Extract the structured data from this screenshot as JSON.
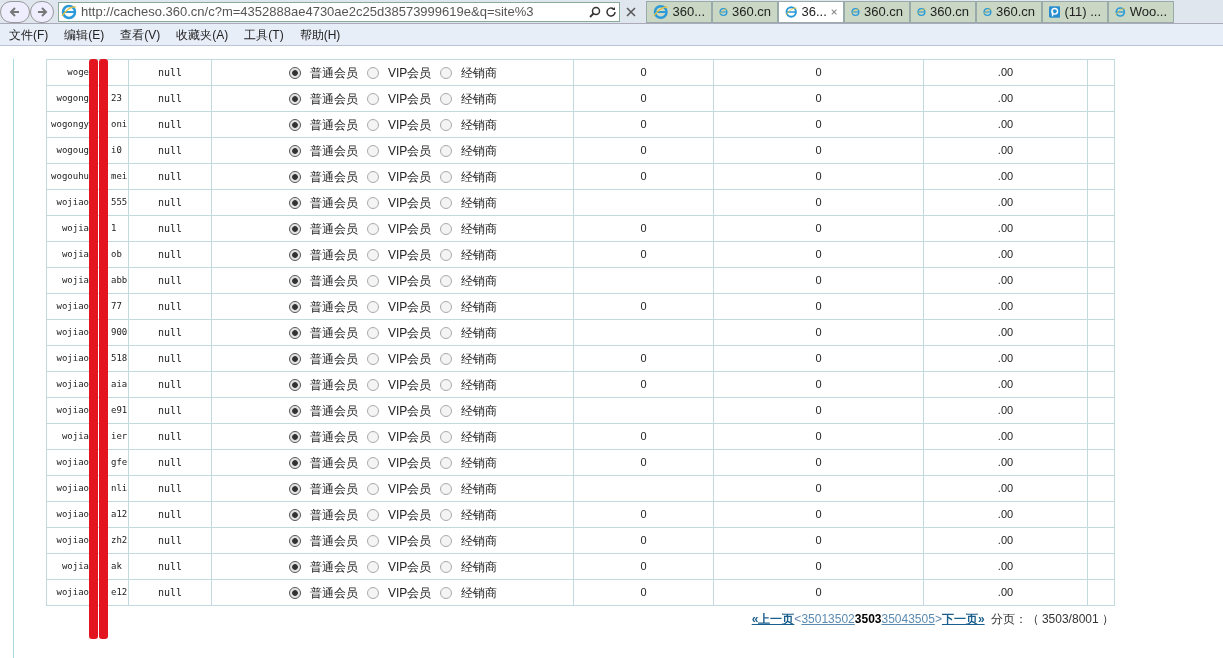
{
  "browser": {
    "url": "http://cacheso.360.cn/c?m=4352888ae4730ae2c25d38573999619e&q=site%3",
    "tabs": [
      {
        "label": "360...",
        "selected": false
      },
      {
        "label": "360.cn",
        "selected": false
      },
      {
        "label": "36...",
        "selected": true
      },
      {
        "label": "360.cn",
        "selected": false
      },
      {
        "label": "360.cn",
        "selected": false
      },
      {
        "label": "360.cn",
        "selected": false
      },
      {
        "label": "(11) ...",
        "selected": false,
        "kind": "p"
      },
      {
        "label": "Woo...",
        "selected": false
      }
    ],
    "menu": [
      "文件(F)",
      "编辑(E)",
      "查看(V)",
      "收藏夹(A)",
      "工具(T)",
      "帮助(H)"
    ]
  },
  "rows": [
    {
      "user_start": "woge",
      "user_end": "",
      "col2": "null",
      "member_options": [
        {
          "label": "普通会员",
          "selected": true
        },
        {
          "label": "VIP会员",
          "selected": false
        },
        {
          "label": "经销商",
          "selected": false
        }
      ],
      "col4": "0",
      "col5": "0",
      "col6": ".00"
    },
    {
      "user_start": "wogong",
      "user_end": "23",
      "col2": "null",
      "member_options": [
        {
          "label": "普通会员",
          "selected": true
        },
        {
          "label": "VIP会员",
          "selected": false
        },
        {
          "label": "经销商",
          "selected": false
        }
      ],
      "col4": "0",
      "col5": "0",
      "col6": ".00"
    },
    {
      "user_start": "wogongy",
      "user_end": "oni",
      "col2": "null",
      "member_options": [
        {
          "label": "普通会员",
          "selected": true
        },
        {
          "label": "VIP会员",
          "selected": false
        },
        {
          "label": "经销商",
          "selected": false
        }
      ],
      "col4": "0",
      "col5": "0",
      "col6": ".00"
    },
    {
      "user_start": "wogoug",
      "user_end": "i0",
      "col2": "null",
      "member_options": [
        {
          "label": "普通会员",
          "selected": true
        },
        {
          "label": "VIP会员",
          "selected": false
        },
        {
          "label": "经销商",
          "selected": false
        }
      ],
      "col4": "0",
      "col5": "0",
      "col6": ".00"
    },
    {
      "user_start": "wogouhu",
      "user_end": "mei",
      "col2": "null",
      "member_options": [
        {
          "label": "普通会员",
          "selected": true
        },
        {
          "label": "VIP会员",
          "selected": false
        },
        {
          "label": "经销商",
          "selected": false
        }
      ],
      "col4": "0",
      "col5": "0",
      "col6": ".00"
    },
    {
      "user_start": "wojiao",
      "user_end": "555",
      "col2": "null",
      "member_options": [
        {
          "label": "普通会员",
          "selected": true
        },
        {
          "label": "VIP会员",
          "selected": false
        },
        {
          "label": "经销商",
          "selected": false
        }
      ],
      "col4": "",
      "col5": "0",
      "col6": ".00"
    },
    {
      "user_start": "wojia",
      "user_end": "1",
      "col2": "null",
      "member_options": [
        {
          "label": "普通会员",
          "selected": true
        },
        {
          "label": "VIP会员",
          "selected": false
        },
        {
          "label": "经销商",
          "selected": false
        }
      ],
      "col4": "0",
      "col5": "0",
      "col6": ".00"
    },
    {
      "user_start": "wojia",
      "user_end": "ob",
      "col2": "null",
      "member_options": [
        {
          "label": "普通会员",
          "selected": true
        },
        {
          "label": "VIP会员",
          "selected": false
        },
        {
          "label": "经销商",
          "selected": false
        }
      ],
      "col4": "0",
      "col5": "0",
      "col6": ".00"
    },
    {
      "user_start": "wojia",
      "user_end": "abb",
      "col2": "null",
      "member_options": [
        {
          "label": "普通会员",
          "selected": true
        },
        {
          "label": "VIP会员",
          "selected": false
        },
        {
          "label": "经销商",
          "selected": false
        }
      ],
      "col4": "",
      "col5": "0",
      "col6": ".00"
    },
    {
      "user_start": "wojiao",
      "user_end": "77",
      "col2": "null",
      "member_options": [
        {
          "label": "普通会员",
          "selected": true
        },
        {
          "label": "VIP会员",
          "selected": false
        },
        {
          "label": "经销商",
          "selected": false
        }
      ],
      "col4": "0",
      "col5": "0",
      "col6": ".00"
    },
    {
      "user_start": "wojiao",
      "user_end": "900",
      "col2": "null",
      "member_options": [
        {
          "label": "普通会员",
          "selected": true
        },
        {
          "label": "VIP会员",
          "selected": false
        },
        {
          "label": "经销商",
          "selected": false
        }
      ],
      "col4": "",
      "col5": "0",
      "col6": ".00"
    },
    {
      "user_start": "wojiao",
      "user_end": "518",
      "col2": "null",
      "member_options": [
        {
          "label": "普通会员",
          "selected": true
        },
        {
          "label": "VIP会员",
          "selected": false
        },
        {
          "label": "经销商",
          "selected": false
        }
      ],
      "col4": "0",
      "col5": "0",
      "col6": ".00"
    },
    {
      "user_start": "wojiao",
      "user_end": "aia",
      "col2": "null",
      "member_options": [
        {
          "label": "普通会员",
          "selected": true
        },
        {
          "label": "VIP会员",
          "selected": false
        },
        {
          "label": "经销商",
          "selected": false
        }
      ],
      "col4": "0",
      "col5": "0",
      "col6": ".00"
    },
    {
      "user_start": "wojiao",
      "user_end": "e91",
      "col2": "null",
      "member_options": [
        {
          "label": "普通会员",
          "selected": true
        },
        {
          "label": "VIP会员",
          "selected": false
        },
        {
          "label": "经销商",
          "selected": false
        }
      ],
      "col4": "",
      "col5": "0",
      "col6": ".00"
    },
    {
      "user_start": "wojia",
      "user_end": "ier",
      "col2": "null",
      "member_options": [
        {
          "label": "普通会员",
          "selected": true
        },
        {
          "label": "VIP会员",
          "selected": false
        },
        {
          "label": "经销商",
          "selected": false
        }
      ],
      "col4": "0",
      "col5": "0",
      "col6": ".00"
    },
    {
      "user_start": "wojiao",
      "user_end": "gfe",
      "col2": "null",
      "member_options": [
        {
          "label": "普通会员",
          "selected": true
        },
        {
          "label": "VIP会员",
          "selected": false
        },
        {
          "label": "经销商",
          "selected": false
        }
      ],
      "col4": "0",
      "col5": "0",
      "col6": ".00"
    },
    {
      "user_start": "wojiao",
      "user_end": "nli",
      "col2": "null",
      "member_options": [
        {
          "label": "普通会员",
          "selected": true
        },
        {
          "label": "VIP会员",
          "selected": false
        },
        {
          "label": "经销商",
          "selected": false
        }
      ],
      "col4": "",
      "col5": "0",
      "col6": ".00"
    },
    {
      "user_start": "wojiao",
      "user_end": "a12",
      "col2": "null",
      "member_options": [
        {
          "label": "普通会员",
          "selected": true
        },
        {
          "label": "VIP会员",
          "selected": false
        },
        {
          "label": "经销商",
          "selected": false
        }
      ],
      "col4": "0",
      "col5": "0",
      "col6": ".00"
    },
    {
      "user_start": "wojiao",
      "user_end": "zh2",
      "col2": "null",
      "member_options": [
        {
          "label": "普通会员",
          "selected": true
        },
        {
          "label": "VIP会员",
          "selected": false
        },
        {
          "label": "经销商",
          "selected": false
        }
      ],
      "col4": "0",
      "col5": "0",
      "col6": ".00"
    },
    {
      "user_start": "wojia",
      "user_end": "ak",
      "col2": "null",
      "member_options": [
        {
          "label": "普通会员",
          "selected": true
        },
        {
          "label": "VIP会员",
          "selected": false
        },
        {
          "label": "经销商",
          "selected": false
        }
      ],
      "col4": "0",
      "col5": "0",
      "col6": ".00"
    },
    {
      "user_start": "wojiao",
      "user_end": "e12",
      "col2": "null",
      "member_options": [
        {
          "label": "普通会员",
          "selected": true
        },
        {
          "label": "VIP会员",
          "selected": false
        },
        {
          "label": "经销商",
          "selected": false
        }
      ],
      "col4": "0",
      "col5": "0",
      "col6": ".00"
    }
  ],
  "pagination": {
    "prev": "«上一页",
    "open": "<",
    "pages": [
      {
        "label": "3501",
        "selected": false
      },
      {
        "label": "3502",
        "selected": false
      },
      {
        "label": "3503",
        "selected": true
      },
      {
        "label": "3504",
        "selected": false
      },
      {
        "label": "3505",
        "selected": false
      }
    ],
    "close": ">",
    "next": "下一页»",
    "summary": "分页：（ 3503/8001 ）"
  }
}
